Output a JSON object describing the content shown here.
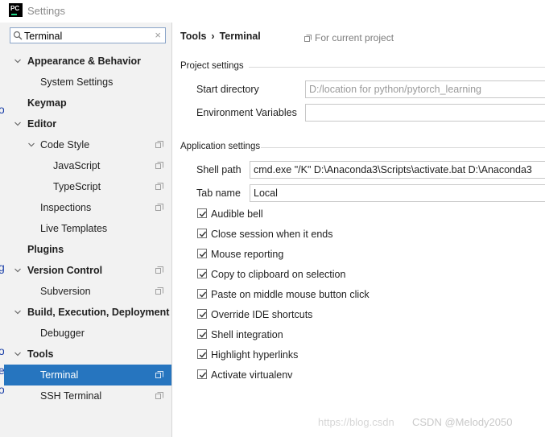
{
  "window": {
    "title": "Settings",
    "logo_text": "PC"
  },
  "search": {
    "value": "Terminal"
  },
  "sidebar": {
    "items": [
      {
        "label": "Appearance & Behavior",
        "bold": true,
        "expanded": true,
        "level": 0,
        "copy": false
      },
      {
        "label": "System Settings",
        "bold": false,
        "level": 1,
        "copy": false
      },
      {
        "label": "Keymap",
        "bold": true,
        "level": 0,
        "copy": false
      },
      {
        "label": "Editor",
        "bold": true,
        "expanded": true,
        "level": 0,
        "copy": false
      },
      {
        "label": "Code Style",
        "bold": false,
        "expanded": true,
        "level": 1,
        "copy": true
      },
      {
        "label": "JavaScript",
        "bold": false,
        "level": 2,
        "copy": true
      },
      {
        "label": "TypeScript",
        "bold": false,
        "level": 2,
        "copy": true
      },
      {
        "label": "Inspections",
        "bold": false,
        "level": 1,
        "copy": true
      },
      {
        "label": "Live Templates",
        "bold": false,
        "level": 1,
        "copy": false
      },
      {
        "label": "Plugins",
        "bold": true,
        "level": 0,
        "copy": false
      },
      {
        "label": "Version Control",
        "bold": true,
        "expanded": true,
        "level": 0,
        "copy": true
      },
      {
        "label": "Subversion",
        "bold": false,
        "level": 1,
        "copy": true
      },
      {
        "label": "Build, Execution, Deployment",
        "bold": true,
        "expanded": true,
        "level": 0,
        "copy": false
      },
      {
        "label": "Debugger",
        "bold": false,
        "level": 1,
        "copy": false
      },
      {
        "label": "Tools",
        "bold": true,
        "expanded": true,
        "level": 0,
        "copy": false
      },
      {
        "label": "Terminal",
        "bold": false,
        "level": 1,
        "copy": true,
        "selected": true
      },
      {
        "label": "SSH Terminal",
        "bold": false,
        "level": 1,
        "copy": true
      }
    ]
  },
  "main": {
    "breadcrumb": {
      "parent": "Tools",
      "separator": "›",
      "current": "Terminal"
    },
    "scope_label": "For current project",
    "project_settings": {
      "title": "Project settings",
      "start_directory_label": "Start directory",
      "start_directory_value": "D:/location for python/pytorch_learning",
      "env_vars_label": "Environment Variables",
      "env_vars_value": ""
    },
    "app_settings": {
      "title": "Application settings",
      "shell_path_label": "Shell path",
      "shell_path_value": "cmd.exe \"/K\" D:\\Anaconda3\\Scripts\\activate.bat D:\\Anaconda3",
      "tab_name_label": "Tab name",
      "tab_name_value": "Local"
    },
    "checkboxes": [
      {
        "label": "Audible bell",
        "checked": true
      },
      {
        "label": "Close session when it ends",
        "checked": true
      },
      {
        "label": "Mouse reporting",
        "checked": true
      },
      {
        "label": "Copy to clipboard on selection",
        "checked": true
      },
      {
        "label": "Paste on middle mouse button click",
        "checked": true
      },
      {
        "label": "Override IDE shortcuts",
        "checked": true
      },
      {
        "label": "Shell integration",
        "checked": true
      },
      {
        "label": "Highlight hyperlinks",
        "checked": true
      },
      {
        "label": "Activate virtualenv",
        "checked": true
      }
    ]
  },
  "watermark": {
    "faint": "https://blog.csdn",
    "text": "CSDN @Melody2050"
  },
  "colors": {
    "selection": "#2675bf",
    "sidebar_bg": "#f2f2f2",
    "accent_green": "#21d789"
  }
}
